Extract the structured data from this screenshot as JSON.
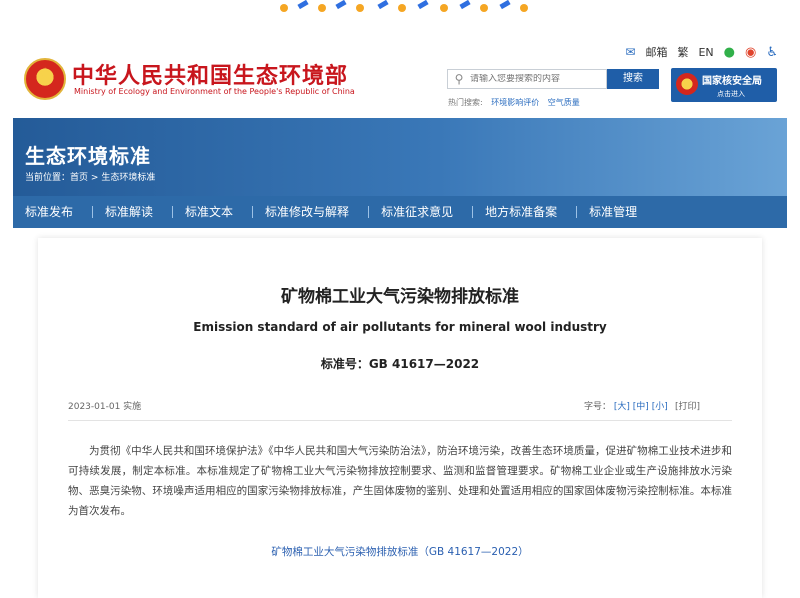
{
  "header": {
    "brand_cn": "中华人民共和国生态环境部",
    "brand_en": "Ministry of Ecology and Environment of the People's Republic of China",
    "toplinks": {
      "mail": "邮箱",
      "traditional": "繁",
      "english": "EN"
    },
    "search": {
      "placeholder": "请输入您要搜索的内容",
      "button": "搜索"
    },
    "hot": {
      "label": "热门搜索:",
      "items": [
        "环境影响评价",
        "空气质量"
      ]
    },
    "nnsa": {
      "title": "国家核安全局",
      "sub": "点击进入"
    }
  },
  "banner": {
    "title": "生态环境标准",
    "crumb_label": "当前位置：",
    "crumb_home": "首页",
    "crumb_sep": ">",
    "crumb_current": "生态环境标准"
  },
  "nav": [
    "标准发布",
    "标准解读",
    "标准文本",
    "标准修改与解释",
    "标准征求意见",
    "地方标准备案",
    "标准管理"
  ],
  "article": {
    "title_cn": "矿物棉工业大气污染物排放标准",
    "title_en": "Emission standard of air pollutants for mineral wool industry",
    "std_no": "标准号：GB 41617—2022",
    "date": "2023-01-01 实施",
    "fontsize_label": "字号：",
    "fs_large": "[大]",
    "fs_medium": "[中]",
    "fs_small": "[小]",
    "print": "[打印]",
    "body": "为贯彻《中华人民共和国环境保护法》《中华人民共和国大气污染防治法》，防治环境污染，改善生态环境质量，促进矿物棉工业技术进步和可持续发展，制定本标准。本标准规定了矿物棉工业大气污染物排放控制要求、监测和监督管理要求。矿物棉工业企业或生产设施排放水污染物、恶臭污染物、环境噪声适用相应的国家污染物排放标准，产生固体废物的鉴别、处理和处置适用相应的国家固体废物污染控制标准。本标准为首次发布。",
    "attachment": "矿物棉工业大气污染物排放标准（GB 41617—2022）"
  },
  "colors": {
    "brand_red": "#c8161d",
    "nav_blue": "#2d6aa8",
    "link_blue": "#2a5fb0"
  }
}
